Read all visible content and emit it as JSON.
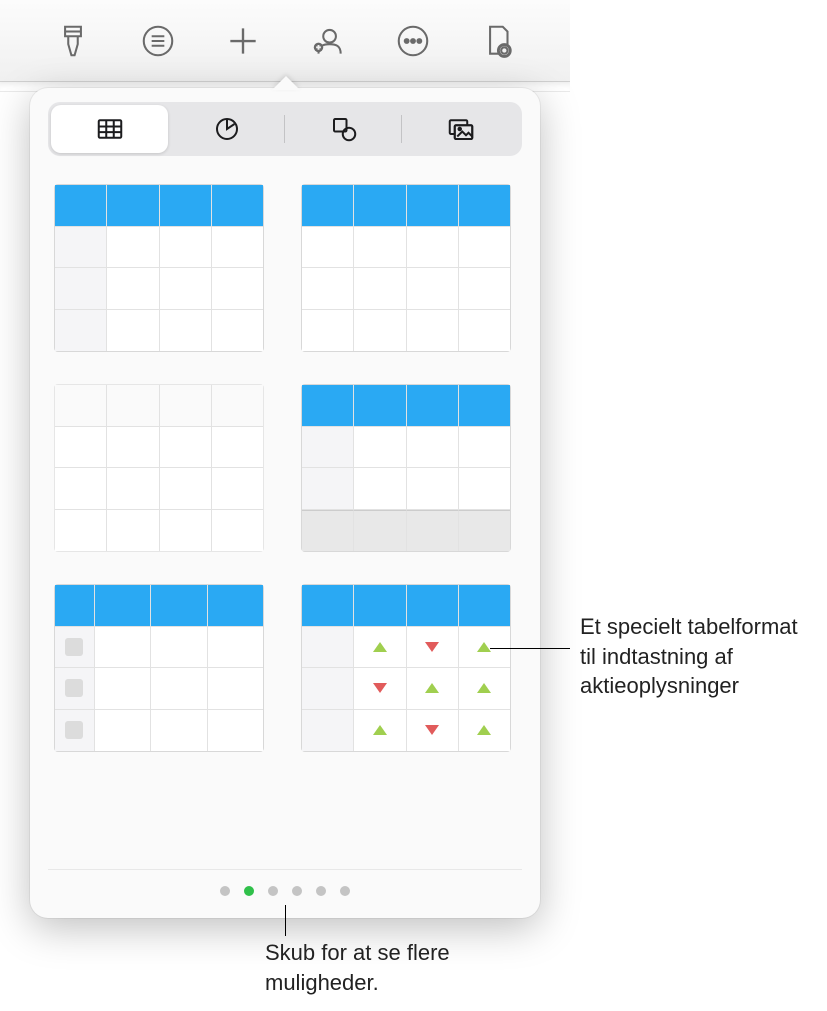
{
  "toolbar": {
    "buttons": [
      {
        "name": "format-brush-icon"
      },
      {
        "name": "list-icon"
      },
      {
        "name": "insert-plus-icon"
      },
      {
        "name": "collaborate-icon"
      },
      {
        "name": "more-icon"
      },
      {
        "name": "document-settings-icon"
      }
    ]
  },
  "popover": {
    "segments": [
      {
        "name": "tables",
        "active": true,
        "icon": "table-icon"
      },
      {
        "name": "charts",
        "active": false,
        "icon": "chart-icon"
      },
      {
        "name": "shapes",
        "active": false,
        "icon": "shapes-icon"
      },
      {
        "name": "media",
        "active": false,
        "icon": "media-icon"
      }
    ],
    "table_styles": [
      {
        "id": "header-rowheader",
        "accent": "#2aa9f3"
      },
      {
        "id": "header-only",
        "accent": "#2aa9f3"
      },
      {
        "id": "plain",
        "accent": "none"
      },
      {
        "id": "header-rowheader-footer",
        "accent": "#2aa9f3"
      },
      {
        "id": "checklist",
        "accent": "#2aa9f3"
      },
      {
        "id": "stocks",
        "accent": "#2aa9f3"
      }
    ],
    "pages": {
      "count": 6,
      "active_index": 1
    }
  },
  "callouts": {
    "stock_table": "Et specielt tabelformat til indtastning af aktieoplysninger",
    "pager": "Skub for at se flere muligheder."
  }
}
